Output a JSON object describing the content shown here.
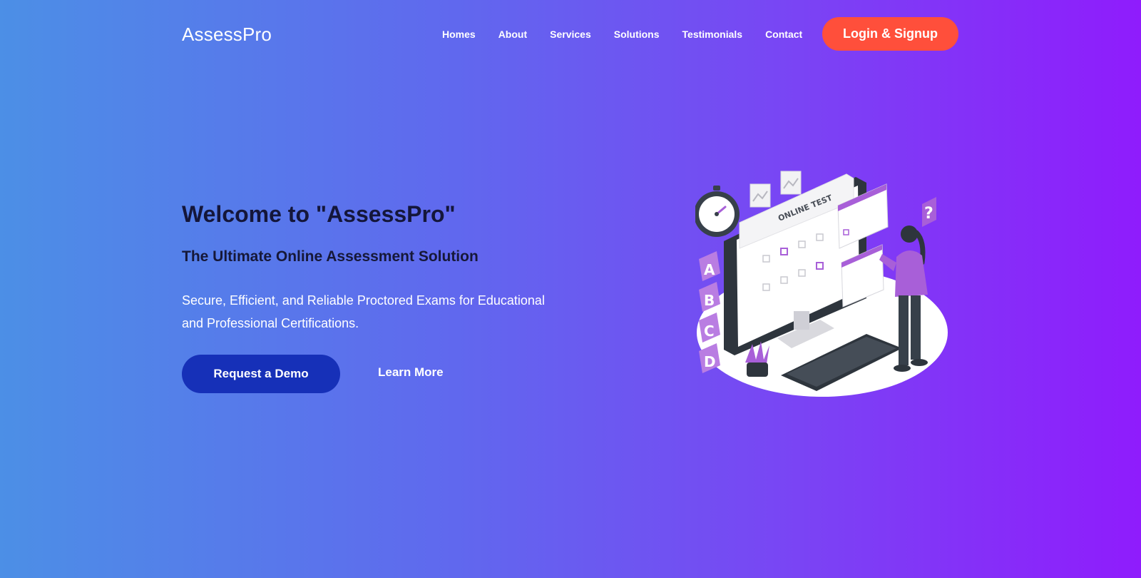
{
  "brand": {
    "name": "AssessPro"
  },
  "nav": {
    "items": [
      {
        "label": "Homes"
      },
      {
        "label": "About"
      },
      {
        "label": "Services"
      },
      {
        "label": "Solutions"
      },
      {
        "label": "Testimonials"
      },
      {
        "label": "Contact"
      }
    ],
    "cta_label": "Login & Signup"
  },
  "hero": {
    "title": "Welcome to \"AssessPro\"",
    "subtitle": "The Ultimate Online Assessment Solution",
    "description": "Secure, Efficient, and Reliable Proctored Exams for Educational and Professional Certifications.",
    "primary_button": "Request a Demo",
    "secondary_link": "Learn More"
  },
  "illustration": {
    "screen_heading": "ONLINE TEST",
    "options": [
      "A",
      "B",
      "C",
      "D"
    ],
    "question_mark": "?"
  },
  "colors": {
    "gradient_start": "#4c8fe6",
    "gradient_end": "#8f1cfc",
    "login_button": "#ff4f3b",
    "demo_button": "#1630b8",
    "heading_text": "#14163a",
    "illustration_accent": "#a85fd8"
  }
}
